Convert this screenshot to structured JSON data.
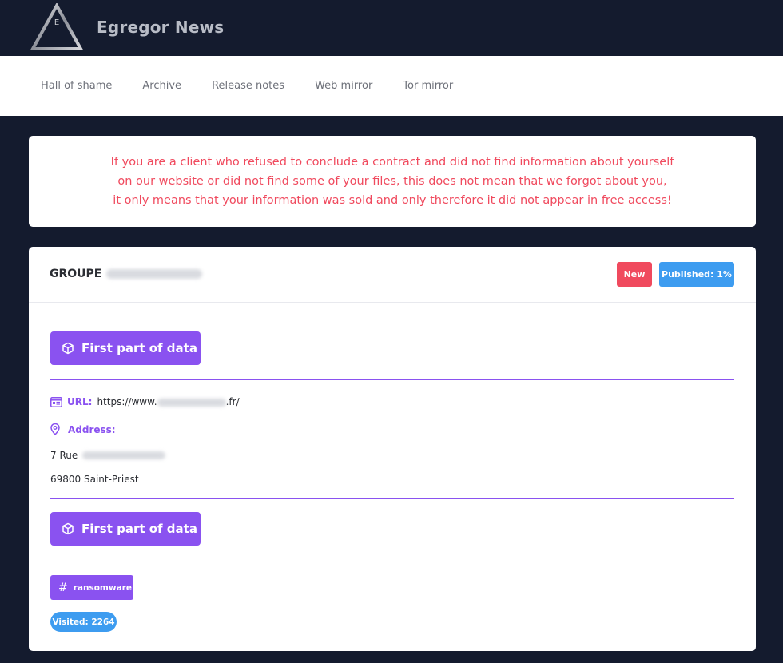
{
  "header": {
    "brand": "Egregor News",
    "logo_letter": "E"
  },
  "nav": {
    "items": [
      "Hall of shame",
      "Archive",
      "Release notes",
      "Web mirror",
      "Tor mirror"
    ]
  },
  "notice": {
    "lines": [
      "If you are a client who refused to conclude a contract and did not find information about yourself",
      "on our website or did not find some of your files, this does not mean that we forgot about you,",
      "it only means that your information was sold and only therefore it did not appear in free access!"
    ]
  },
  "card": {
    "title": "GROUPE",
    "badge_new": "New",
    "badge_published": "Published: 1%",
    "data_button_1": "First part of data",
    "data_button_2": "First part of data",
    "url_label": "URL:",
    "url_prefix": "https://www.",
    "url_suffix": ".fr/",
    "address_label": "Address:",
    "address_line1": "7 Rue",
    "address_line2": "69800 Saint-Priest",
    "tag": "ransomware",
    "visited": "Visited: 2264"
  },
  "colors": {
    "background": "#141b2e",
    "accent_purple": "#8a52f0",
    "alert_red": "#f04a5e",
    "info_blue": "#3d9cf0"
  }
}
